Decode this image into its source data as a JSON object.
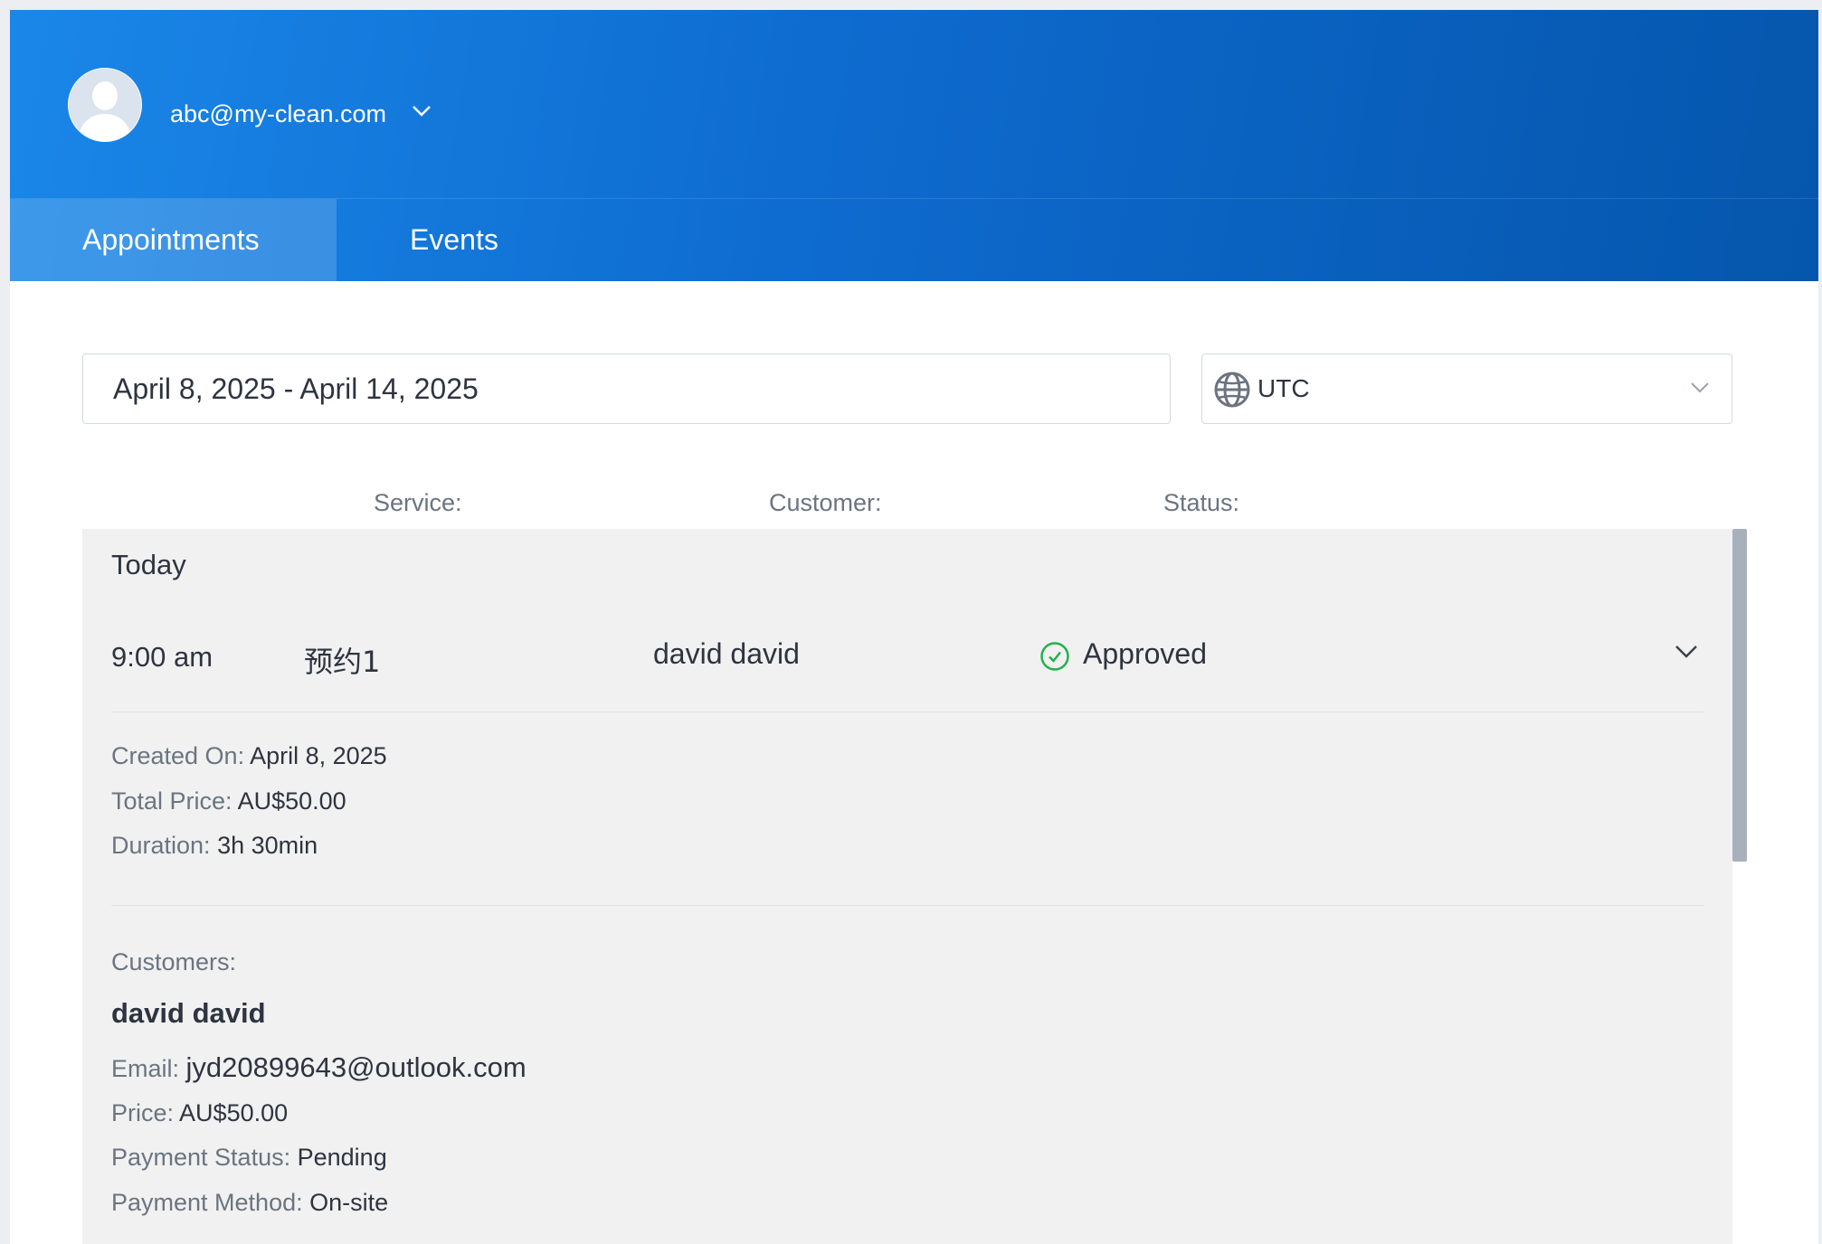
{
  "header": {
    "user_email": "abc@my-clean.com",
    "avatar_icon": "user-silhouette-icon",
    "tabs": [
      {
        "label": "Appointments",
        "active": true
      },
      {
        "label": "Events",
        "active": false
      }
    ],
    "colors": {
      "gradient_start": "#1a87e8",
      "gradient_end": "#0556ac"
    }
  },
  "filters": {
    "date_range": "April 8, 2025 - April 14, 2025",
    "timezone": "UTC",
    "timezone_icon": "globe-icon"
  },
  "columns": {
    "service": "Service:",
    "customer": "Customer:",
    "status": "Status:"
  },
  "list": {
    "group_label": "Today",
    "appointment": {
      "time": "9:00 am",
      "service": "预约1",
      "customer": "david david",
      "status": "Approved",
      "status_color": "#22b14c",
      "details": {
        "created_on_label": "Created On:",
        "created_on": "April 8, 2025",
        "total_price_label": "Total Price:",
        "total_price": "AU$50.00",
        "duration_label": "Duration:",
        "duration": "3h 30min"
      },
      "customers_section": {
        "title": "Customers:",
        "name": "david david",
        "email_label": "Email:",
        "email": "jyd20899643@outlook.com",
        "price_label": "Price:",
        "price": "AU$50.00",
        "payment_status_label": "Payment Status:",
        "payment_status": "Pending",
        "payment_method_label": "Payment Method:",
        "payment_method": "On-site"
      }
    }
  }
}
